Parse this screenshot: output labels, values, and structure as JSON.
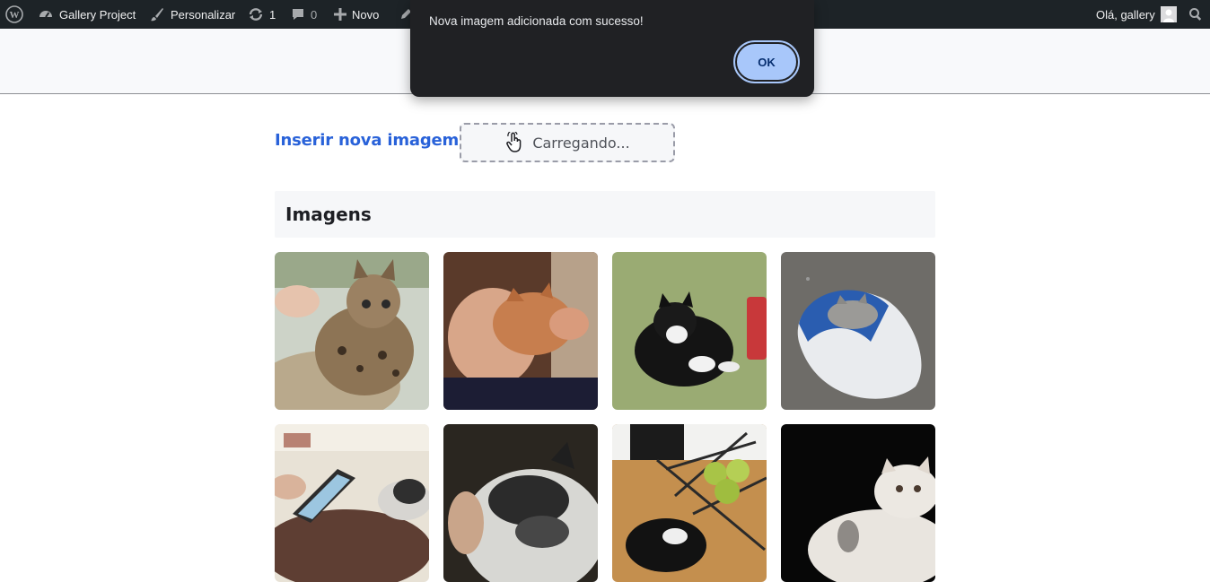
{
  "adminbar": {
    "site_name": "Gallery Project",
    "customize": "Personalizar",
    "updates_count": "1",
    "comments_count": "0",
    "new_label": "Novo",
    "greeting": "Olá, gallery"
  },
  "upload": {
    "label": "Inserir nova imagem",
    "status": "Carregando..."
  },
  "section": {
    "title": "Imagens"
  },
  "dialog": {
    "message": "Nova imagem adicionada com sucesso!",
    "ok_label": "OK"
  },
  "colors": {
    "accent": "#2962d9",
    "adminbar_bg": "#1d2327",
    "dialog_bg": "#202124",
    "ok_button": "#a8c7fa"
  },
  "gallery": [
    {
      "alt": "bengal kitten"
    },
    {
      "alt": "man sleeping with cat"
    },
    {
      "alt": "black and white cat on green blanket"
    },
    {
      "alt": "kitten sleeping in slipper"
    },
    {
      "alt": "cat with tablet"
    },
    {
      "alt": "sleeping black and white cat"
    },
    {
      "alt": "cat under fruit bowl"
    },
    {
      "alt": "white persian cat"
    }
  ]
}
